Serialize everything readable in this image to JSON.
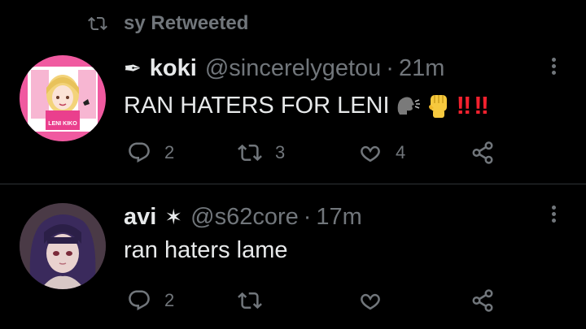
{
  "retweet_banner": {
    "text": "sy Retweeted",
    "icon": "retweet-icon"
  },
  "tweets": [
    {
      "badge": "✒",
      "name": "koki",
      "handle": "@sincerelygetou",
      "separator": "·",
      "time": "21m",
      "text": "RAN HATERS FOR LENI",
      "emojis": [
        "speaking-head",
        "raised-fist",
        "double-exclamation",
        "double-exclamation"
      ],
      "bang": "‼",
      "avatar_text": "LENI KIKO",
      "replies": "2",
      "retweets": "3",
      "likes": "4"
    },
    {
      "badge": "✶",
      "name": "avi",
      "handle": "@s62core",
      "separator": "·",
      "time": "17m",
      "text": "ran haters lame",
      "replies": "2",
      "retweets": "",
      "likes": ""
    }
  ],
  "colors": {
    "background": "#000000",
    "text": "#e7e9ea",
    "muted": "#71767b",
    "divider": "#2f3336",
    "alert": "#f4212e"
  }
}
